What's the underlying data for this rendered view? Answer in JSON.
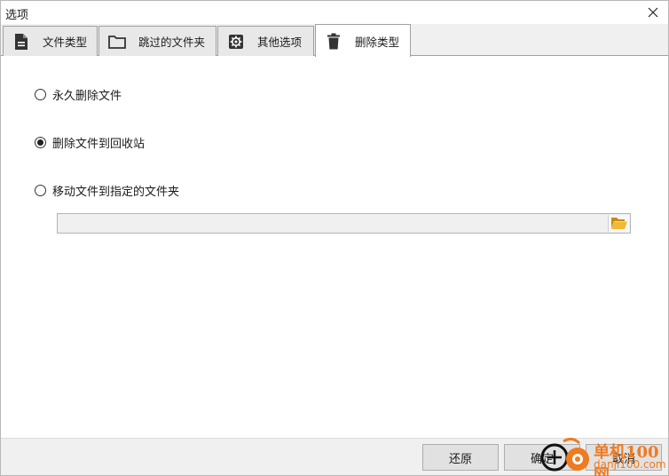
{
  "window": {
    "title": "选项"
  },
  "tabs": [
    {
      "label": "文件类型",
      "icon": "document-icon"
    },
    {
      "label": "跳过的文件夹",
      "icon": "folder-icon"
    },
    {
      "label": "其他选项",
      "icon": "gear-icon"
    },
    {
      "label": "删除类型",
      "icon": "trash-icon",
      "active": true
    }
  ],
  "delete_options": {
    "permanent": "永久删除文件",
    "recycle": "删除文件到回收站",
    "move": "移动文件到指定的文件夹",
    "selected": "recycle",
    "target_folder_value": ""
  },
  "buttons": {
    "restore": "还原",
    "ok": "确定",
    "cancel": "取消"
  },
  "watermark": {
    "line1": "单机100网",
    "line2": "danji100.com"
  },
  "colors": {
    "accent_orange": "#f07a1f",
    "folder_yellow": "#e8a92e"
  }
}
